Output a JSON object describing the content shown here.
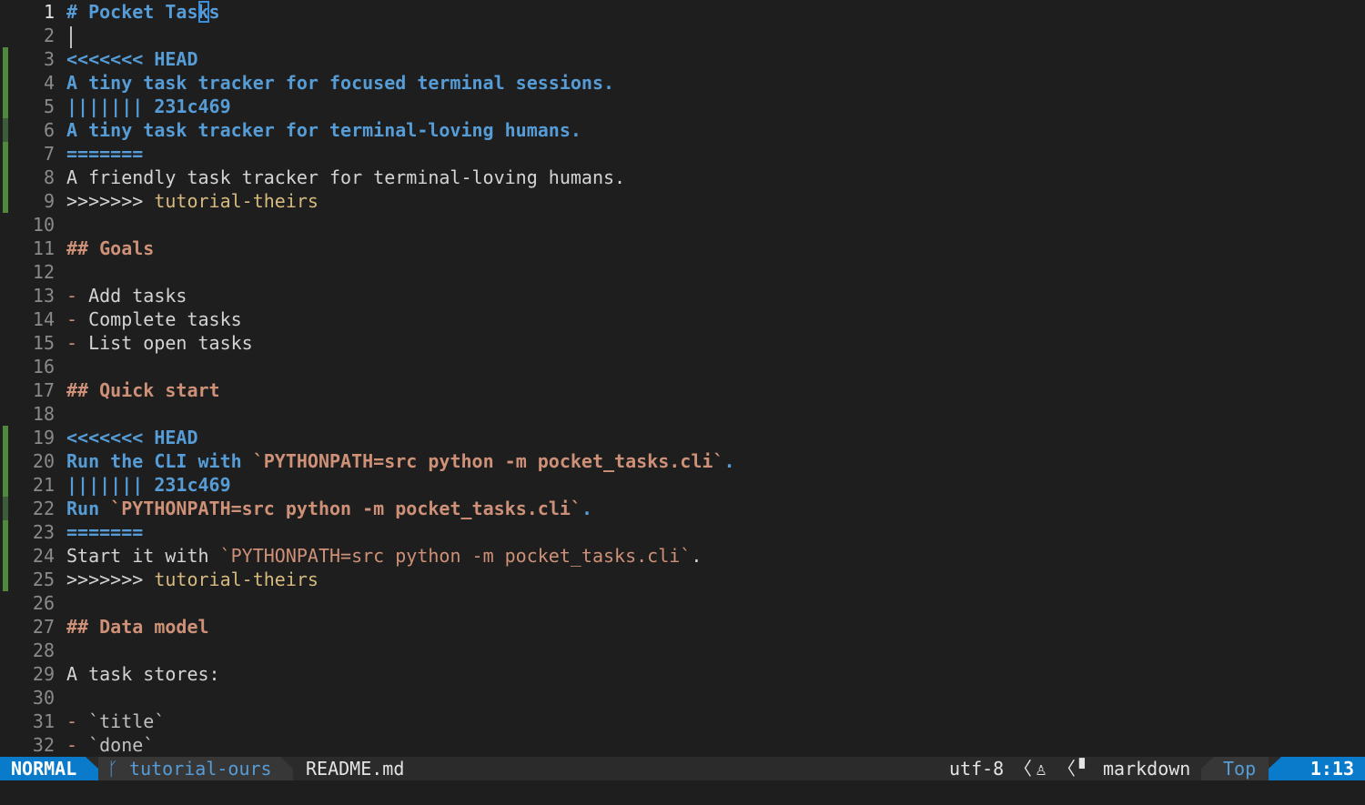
{
  "colors": {
    "background": "#1e1e1e",
    "mode_bg": "#0a7aca",
    "heading_blue": "#569cd6",
    "heading_orange": "#ce9178",
    "git_added": "#4f8a3c"
  },
  "lines": [
    {
      "n": "1",
      "segs": [
        {
          "t": "# Pocket Tas",
          "c": "hblue"
        },
        {
          "t": "k",
          "c": "hblue",
          "cursor": true
        },
        {
          "t": "s",
          "c": "hblue"
        }
      ]
    },
    {
      "n": "2",
      "segs": [],
      "bar": true
    },
    {
      "n": "3",
      "sign": "added",
      "segs": [
        {
          "t": "<<<<<<< HEAD",
          "c": "hblue"
        }
      ]
    },
    {
      "n": "4",
      "sign": "added",
      "segs": [
        {
          "t": "A tiny task tracker for focused terminal sessions.",
          "c": "hblue"
        }
      ]
    },
    {
      "n": "5",
      "sign": "added",
      "segs": [
        {
          "t": "||||||| 231c469",
          "c": "hblue"
        }
      ]
    },
    {
      "n": "6",
      "sign": "changed",
      "segs": [
        {
          "t": "A tiny task tracker for terminal-loving humans.",
          "c": "hblue"
        }
      ]
    },
    {
      "n": "7",
      "sign": "added",
      "segs": [
        {
          "t": "=======",
          "c": "hblue"
        }
      ]
    },
    {
      "n": "8",
      "sign": "added",
      "segs": [
        {
          "t": "A friendly task tracker for terminal-loving humans.",
          "c": "plain"
        }
      ]
    },
    {
      "n": "9",
      "sign": "added",
      "segs": [
        {
          "t": ">>>>>>> ",
          "c": "plain"
        },
        {
          "t": "tutorial-theirs",
          "c": "yellow"
        }
      ]
    },
    {
      "n": "10",
      "segs": []
    },
    {
      "n": "11",
      "segs": [
        {
          "t": "## Goals",
          "c": "horange"
        }
      ]
    },
    {
      "n": "12",
      "segs": []
    },
    {
      "n": "13",
      "segs": [
        {
          "t": "- ",
          "c": "orange"
        },
        {
          "t": "Add tasks",
          "c": "plain"
        }
      ]
    },
    {
      "n": "14",
      "segs": [
        {
          "t": "- ",
          "c": "orange"
        },
        {
          "t": "Complete tasks",
          "c": "plain"
        }
      ]
    },
    {
      "n": "15",
      "segs": [
        {
          "t": "- ",
          "c": "orange"
        },
        {
          "t": "List open tasks",
          "c": "plain"
        }
      ]
    },
    {
      "n": "16",
      "segs": []
    },
    {
      "n": "17",
      "segs": [
        {
          "t": "## Quick start",
          "c": "horange"
        }
      ]
    },
    {
      "n": "18",
      "segs": []
    },
    {
      "n": "19",
      "sign": "added",
      "segs": [
        {
          "t": "<<<<<<< HEAD",
          "c": "hblue"
        }
      ]
    },
    {
      "n": "20",
      "sign": "added",
      "segs": [
        {
          "t": "Run the CLI with ",
          "c": "hblue"
        },
        {
          "t": "`PYTHONPATH=src python -m pocket_tasks.cli`",
          "c": "horange"
        },
        {
          "t": ".",
          "c": "hblue"
        }
      ]
    },
    {
      "n": "21",
      "sign": "added",
      "segs": [
        {
          "t": "||||||| 231c469",
          "c": "hblue"
        }
      ]
    },
    {
      "n": "22",
      "sign": "changed",
      "segs": [
        {
          "t": "Run ",
          "c": "hblue"
        },
        {
          "t": "`PYTHONPATH=src python -m pocket_tasks.cli`",
          "c": "horange"
        },
        {
          "t": ".",
          "c": "hblue"
        }
      ]
    },
    {
      "n": "23",
      "sign": "added",
      "segs": [
        {
          "t": "=======",
          "c": "hblue"
        }
      ]
    },
    {
      "n": "24",
      "sign": "added",
      "segs": [
        {
          "t": "Start it with ",
          "c": "plain"
        },
        {
          "t": "`PYTHONPATH=src python -m pocket_tasks.cli`",
          "c": "orange"
        },
        {
          "t": ".",
          "c": "plain"
        }
      ]
    },
    {
      "n": "25",
      "sign": "added",
      "segs": [
        {
          "t": ">>>>>>> ",
          "c": "plain"
        },
        {
          "t": "tutorial-theirs",
          "c": "yellow"
        }
      ]
    },
    {
      "n": "26",
      "segs": []
    },
    {
      "n": "27",
      "segs": [
        {
          "t": "## Data model",
          "c": "horange"
        }
      ]
    },
    {
      "n": "28",
      "segs": []
    },
    {
      "n": "29",
      "segs": [
        {
          "t": "A task stores:",
          "c": "plain"
        }
      ]
    },
    {
      "n": "30",
      "segs": []
    },
    {
      "n": "31",
      "segs": [
        {
          "t": "- ",
          "c": "orange"
        },
        {
          "t": "`title`",
          "c": "dim"
        }
      ]
    },
    {
      "n": "32",
      "segs": [
        {
          "t": "- ",
          "c": "orange"
        },
        {
          "t": "`done`",
          "c": "dim"
        }
      ]
    }
  ],
  "statusline": {
    "mode": "NORMAL",
    "branch_icon": "git-branch-icon",
    "branch_glyph": "ᚴ",
    "branch": "tutorial-ours",
    "filename": "README.md",
    "encoding": "utf-8",
    "separator": "〈",
    "os_icon": "linux-penguin-icon",
    "os_glyph": "♙",
    "filetype_icon": "file-icon",
    "filetype_glyph": "▘",
    "filetype": "markdown",
    "scroll_position": "Top",
    "cursor_position": "1:13"
  }
}
